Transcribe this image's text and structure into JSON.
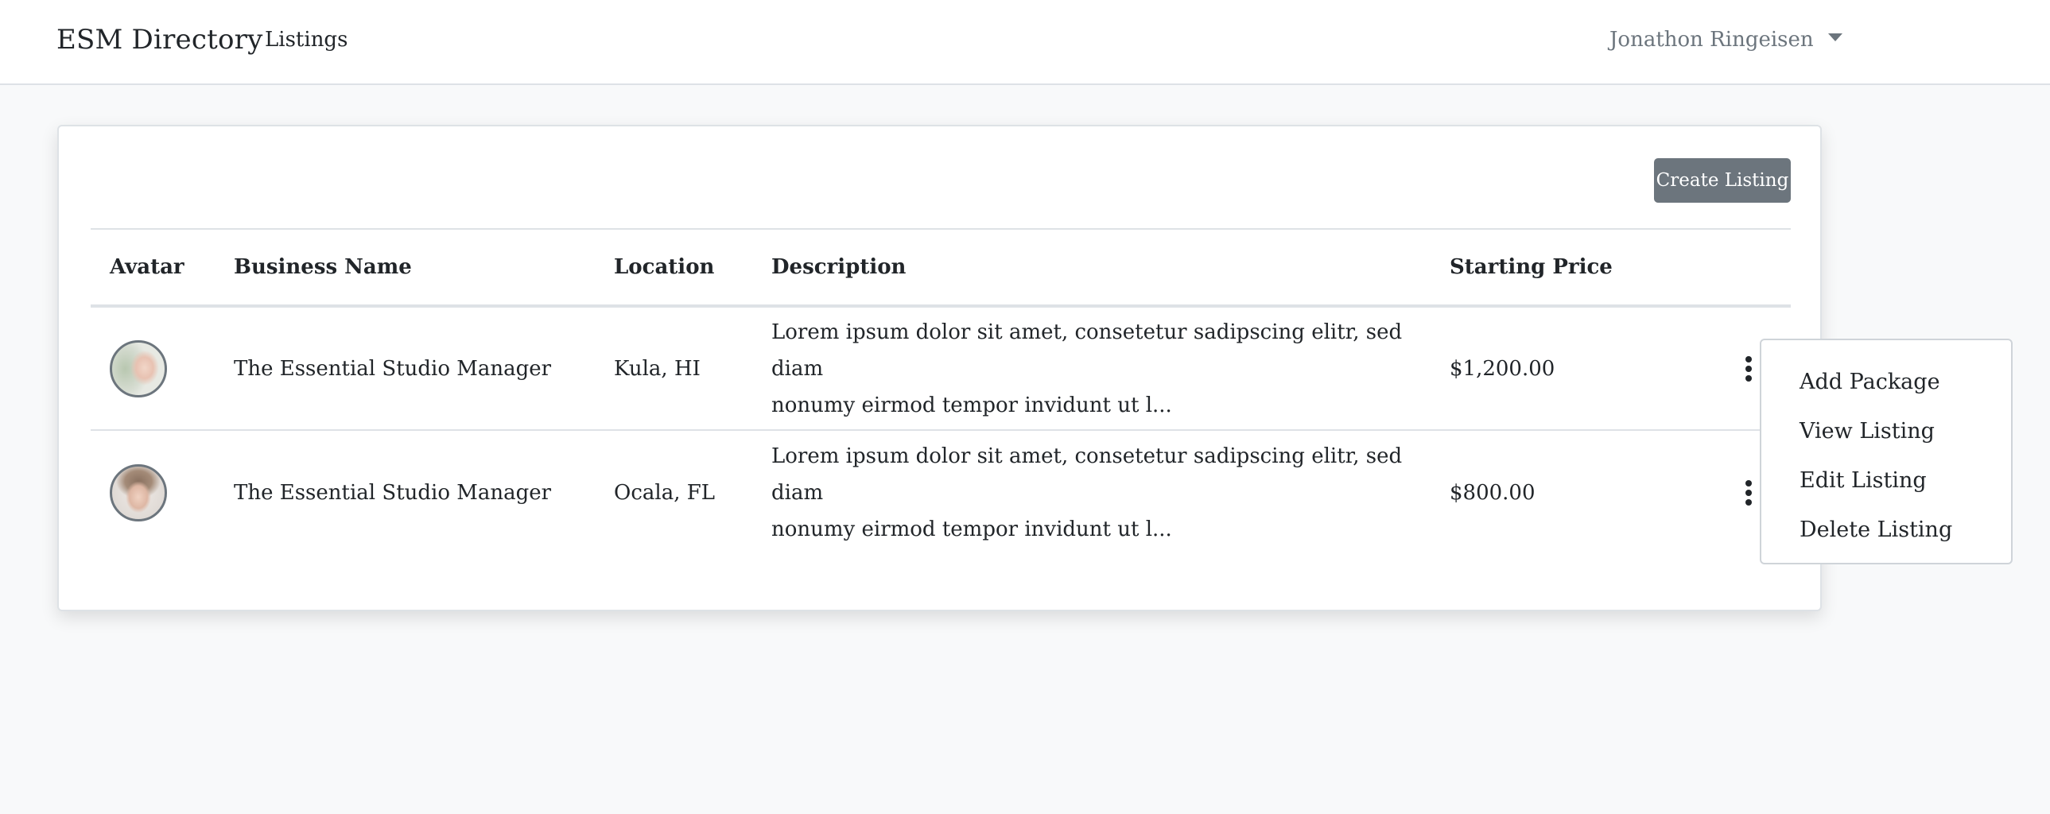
{
  "navbar": {
    "brand": "ESM Directory",
    "listings_link": "Listings",
    "user_name": "Jonathon Ringeisen",
    "user_caret_icon": "caret-down-icon"
  },
  "card": {
    "create_button": "Create Listing"
  },
  "table": {
    "headers": {
      "avatar": "Avatar",
      "business_name": "Business Name",
      "location": "Location",
      "description": "Description",
      "starting_price": "Starting Price"
    },
    "rows": [
      {
        "business_name": "The Essential Studio Manager",
        "location": "Kula, HI",
        "description_line1": "Lorem ipsum dolor sit amet, consetetur sadipscing elitr, sed diam",
        "description_line2": "nonumy eirmod tempor invidunt ut l...",
        "starting_price": "$1,200.00",
        "actions_icon": "more-vertical-icon"
      },
      {
        "business_name": "The Essential Studio Manager",
        "location": "Ocala, FL",
        "description_line1": "Lorem ipsum dolor sit amet, consetetur sadipscing elitr, sed diam",
        "description_line2": "nonumy eirmod tempor invidunt ut l...",
        "starting_price": "$800.00",
        "actions_icon": "more-vertical-icon"
      }
    ]
  },
  "dropdown": {
    "items": [
      "Add Package",
      "View Listing",
      "Edit Listing",
      "Delete Listing"
    ]
  },
  "colors": {
    "page_bg": "#f8f9fa",
    "button_bg": "#6c757d",
    "text": "#212529",
    "muted": "#6c757d",
    "border": "#dee2e6"
  }
}
